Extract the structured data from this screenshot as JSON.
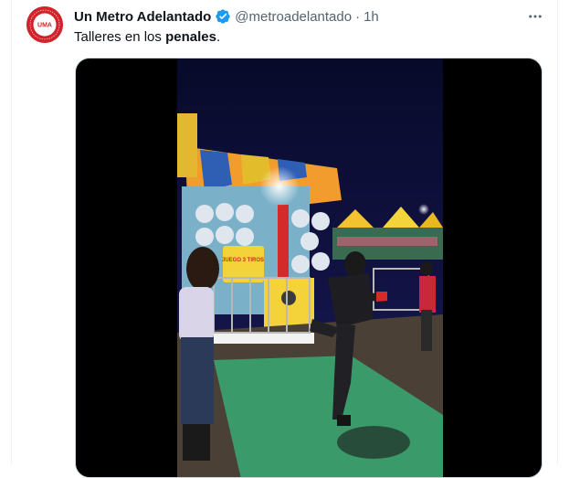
{
  "tweet": {
    "display_name": "Un Metro Adelantado",
    "handle": "@metroadelantado",
    "separator": "·",
    "time": "1h",
    "text_prefix": "Talleres en los ",
    "text_bold": "penales",
    "text_suffix": ".",
    "verified": true,
    "verified_color": "#1d9bf0"
  },
  "avatar": {
    "logo_text": "UMA",
    "ring_text": "UN METRO ADELANTADO",
    "brand_color": "#d0232a"
  },
  "media": {
    "type": "video",
    "booth_sign": "JUEGO 3 TIROS"
  },
  "icons": {
    "verified": "verified-badge-icon",
    "more": "more-horizontal-icon"
  }
}
